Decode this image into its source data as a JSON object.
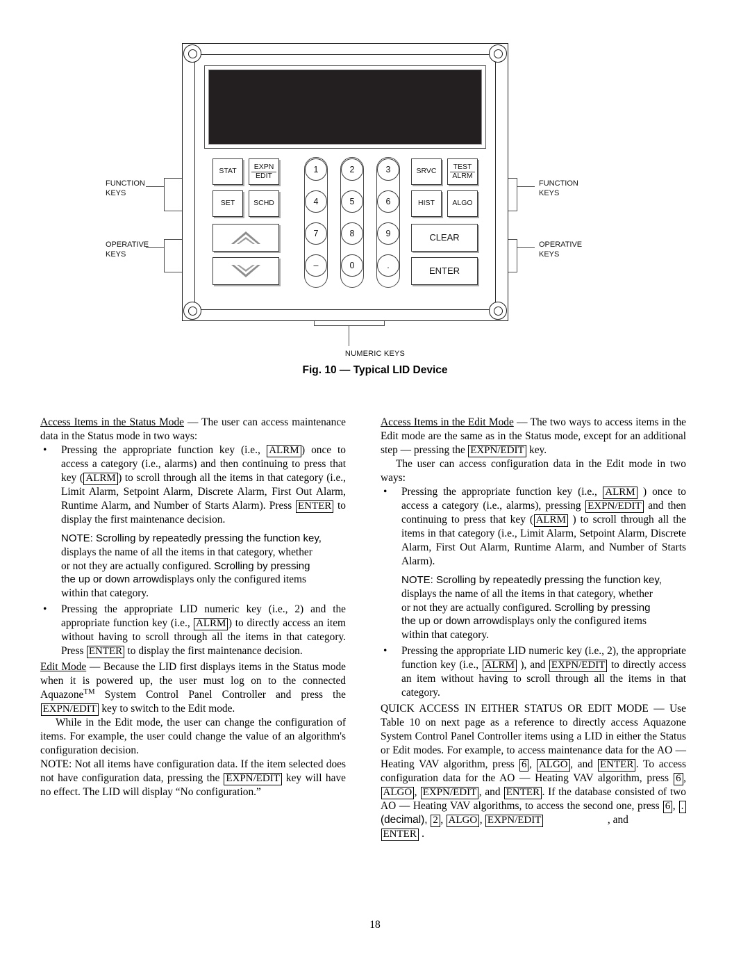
{
  "figure": {
    "caption": "Fig. 10 — Typical LID Device",
    "numeric_keys_label": "NUMERIC KEYS",
    "callouts": {
      "function_keys_left": "FUNCTION\nKEYS",
      "operative_keys_left": "OPERATIVE\nKEYS",
      "function_keys_right": "FUNCTION\nKEYS",
      "operative_keys_right": "OPERATIVE\nKEYS"
    },
    "keys": {
      "stat": "STAT",
      "expn": "EXPN",
      "edit": "EDIT",
      "set": "SET",
      "schd": "SCHD",
      "srvc": "SRVC",
      "test": "TEST",
      "alrm": "ALRM",
      "hist": "HIST",
      "algo": "ALGO",
      "clear": "CLEAR",
      "enter": "ENTER",
      "up_arrow": "up-arrow",
      "down_arrow": "down-arrow"
    },
    "numeric_keys": {
      "col1": [
        "1",
        "4",
        "7",
        "–"
      ],
      "col2": [
        "2",
        "5",
        "8",
        "0"
      ],
      "col3": [
        "3",
        "6",
        "9",
        "."
      ]
    },
    "display_color": "#231f20"
  },
  "left_column": {
    "status_heading": "Access Items in the Status Mode",
    "status_intro_dash": " — The user can access maintenance data in the Status mode in two ways:",
    "bullet": "•",
    "b1_p1": "Pressing the appropriate function key (i.e., ",
    "b1_k1": "ALRM",
    "b1_p2": ") once to access a category (i.e., alarms) and then continuing to press that key (",
    "b1_k2": "ALRM",
    "b1_p3": ") to scroll through all the items in that category (i.e., Limit Alarm, Setpoint Alarm, Discrete Alarm, First Out Alarm, Runtime Alarm, and Number of Starts Alarm). Press ",
    "b1_k3": "ENTER",
    "b1_p4": " to display the first maintenance decision.",
    "note1_l1": "NOTE: Scrolling by repeatedly pressing the function key,",
    "note1_l2": "displays the name of all the items in that category, whether",
    "note1_l3a": "or not they are actually configured. ",
    "note1_l3b": "Scrolling by pressing",
    "note1_l4a": "the up or down arrow",
    "note1_l4b": "displays only the configured items",
    "note1_l5": "within that category.",
    "b2_p1": "Pressing the appropriate LID numeric key (i.e., 2) and the appropriate function key (i.e., ",
    "b2_k1": "ALRM",
    "b2_p2": ") to directly access an item without having to scroll through all the items in that category. Press ",
    "b2_k2": "ENTER",
    "b2_p3": " to display the first maintenance decision.",
    "edit_heading": "Edit Mode",
    "edit_p1": " — Because the LID first displays items in the Status mode when it is powered up, the user must log on to the connected Aquazone",
    "edit_tm": "TM",
    "edit_p2": " System Control Panel Controller and press the ",
    "edit_k1": "EXPN/EDIT",
    "edit_p3": " key to switch to the Edit mode.",
    "edit_p4": "While in the Edit mode, the user can change the configuration of items. For example, the user could change the value of an algorithm's configuration decision.",
    "note2_p1": "NOTE: Not all items have configuration data. If the item selected does not have configuration data, pressing the ",
    "note2_k1": "EXPN/EDIT",
    "note2_p2": " key will have no effect. The LID will display “No configuration.”"
  },
  "right_column": {
    "edit_access_heading": "Access Items in the Edit Mode",
    "edit_access_p1": " — The two ways to access items in the Edit mode are the same as in the Status mode, except for an additional step — pressing the ",
    "edit_access_k1": "EXPN/EDIT",
    "edit_access_p2": " key.",
    "config_p1": "The user can access configuration data in the Edit mode in two ways:",
    "bullet": "•",
    "rb1_p1": "Pressing the appropriate function key (i.e., ",
    "rb1_k1": "ALRM",
    "rb1_p2": " ) once to access a category (i.e., alarms), pressing ",
    "rb1_k2": "EXPN/EDIT",
    "rb1_p3": " and then continuing to press that key (",
    "rb1_k3": "ALRM",
    "rb1_p4": " ) to scroll through all the items in that category (i.e., Limit Alarm, Setpoint Alarm, Discrete Alarm, First Out Alarm, Runtime Alarm, and Number of Starts Alarm).",
    "note3_l1": "NOTE: Scrolling by repeatedly pressing the function key,",
    "note3_l2": "displays the name of all the items in that category, whether",
    "note3_l3a": "or not they are actually configured. ",
    "note3_l3b": "Scrolling by pressing",
    "note3_l4a": "the up or down arrow",
    "note3_l4b": "displays only the configured items",
    "note3_l5": "within that category.",
    "rb2_p1": "Pressing the appropriate LID numeric key (i.e., 2), the appropriate function key (i.e., ",
    "rb2_k1": "ALRM",
    "rb2_p2": " ), and ",
    "rb2_k2": "EXPN/EDIT",
    "rb2_p3": " to directly access an item without having to scroll through all the items in that category.",
    "quick_p1": "QUICK ACCESS IN EITHER STATUS OR EDIT MODE — Use Table 10 on next page as a reference to directly access Aquazone System Control Panel Controller items using a LID in either the Status or Edit modes. For example, to access maintenance data for the AO — Heating VAV algorithm, press ",
    "quick_k1": "6",
    "quick_p2": ", ",
    "quick_k2": "ALGO",
    "quick_p3": ", and ",
    "quick_k3": "ENTER",
    "quick_p4": ". To access configuration data for the AO — Heating VAV algorithm, press ",
    "quick_k4": "6",
    "quick_p5": ", ",
    "quick_k5": "ALGO",
    "quick_p6": ", ",
    "quick_k6": "EXPN/EDIT",
    "quick_p7": ", and ",
    "quick_k7": "ENTER",
    "quick_p8": ". If the database consisted of two AO — Heating VAV algorithms, to access the second one, press ",
    "quick_k8": "6",
    "quick_p9": ", ",
    "quick_k9": ".",
    "quick_p10": " (decimal), ",
    "quick_k10": "2",
    "quick_p11": ", ",
    "quick_k11": "ALGO",
    "quick_p12": ", ",
    "quick_k12": "EXPN/EDIT",
    "quick_p13": ", and ",
    "quick_k13": "ENTER",
    "quick_p14": " ."
  },
  "footer": {
    "page_number": "18"
  }
}
